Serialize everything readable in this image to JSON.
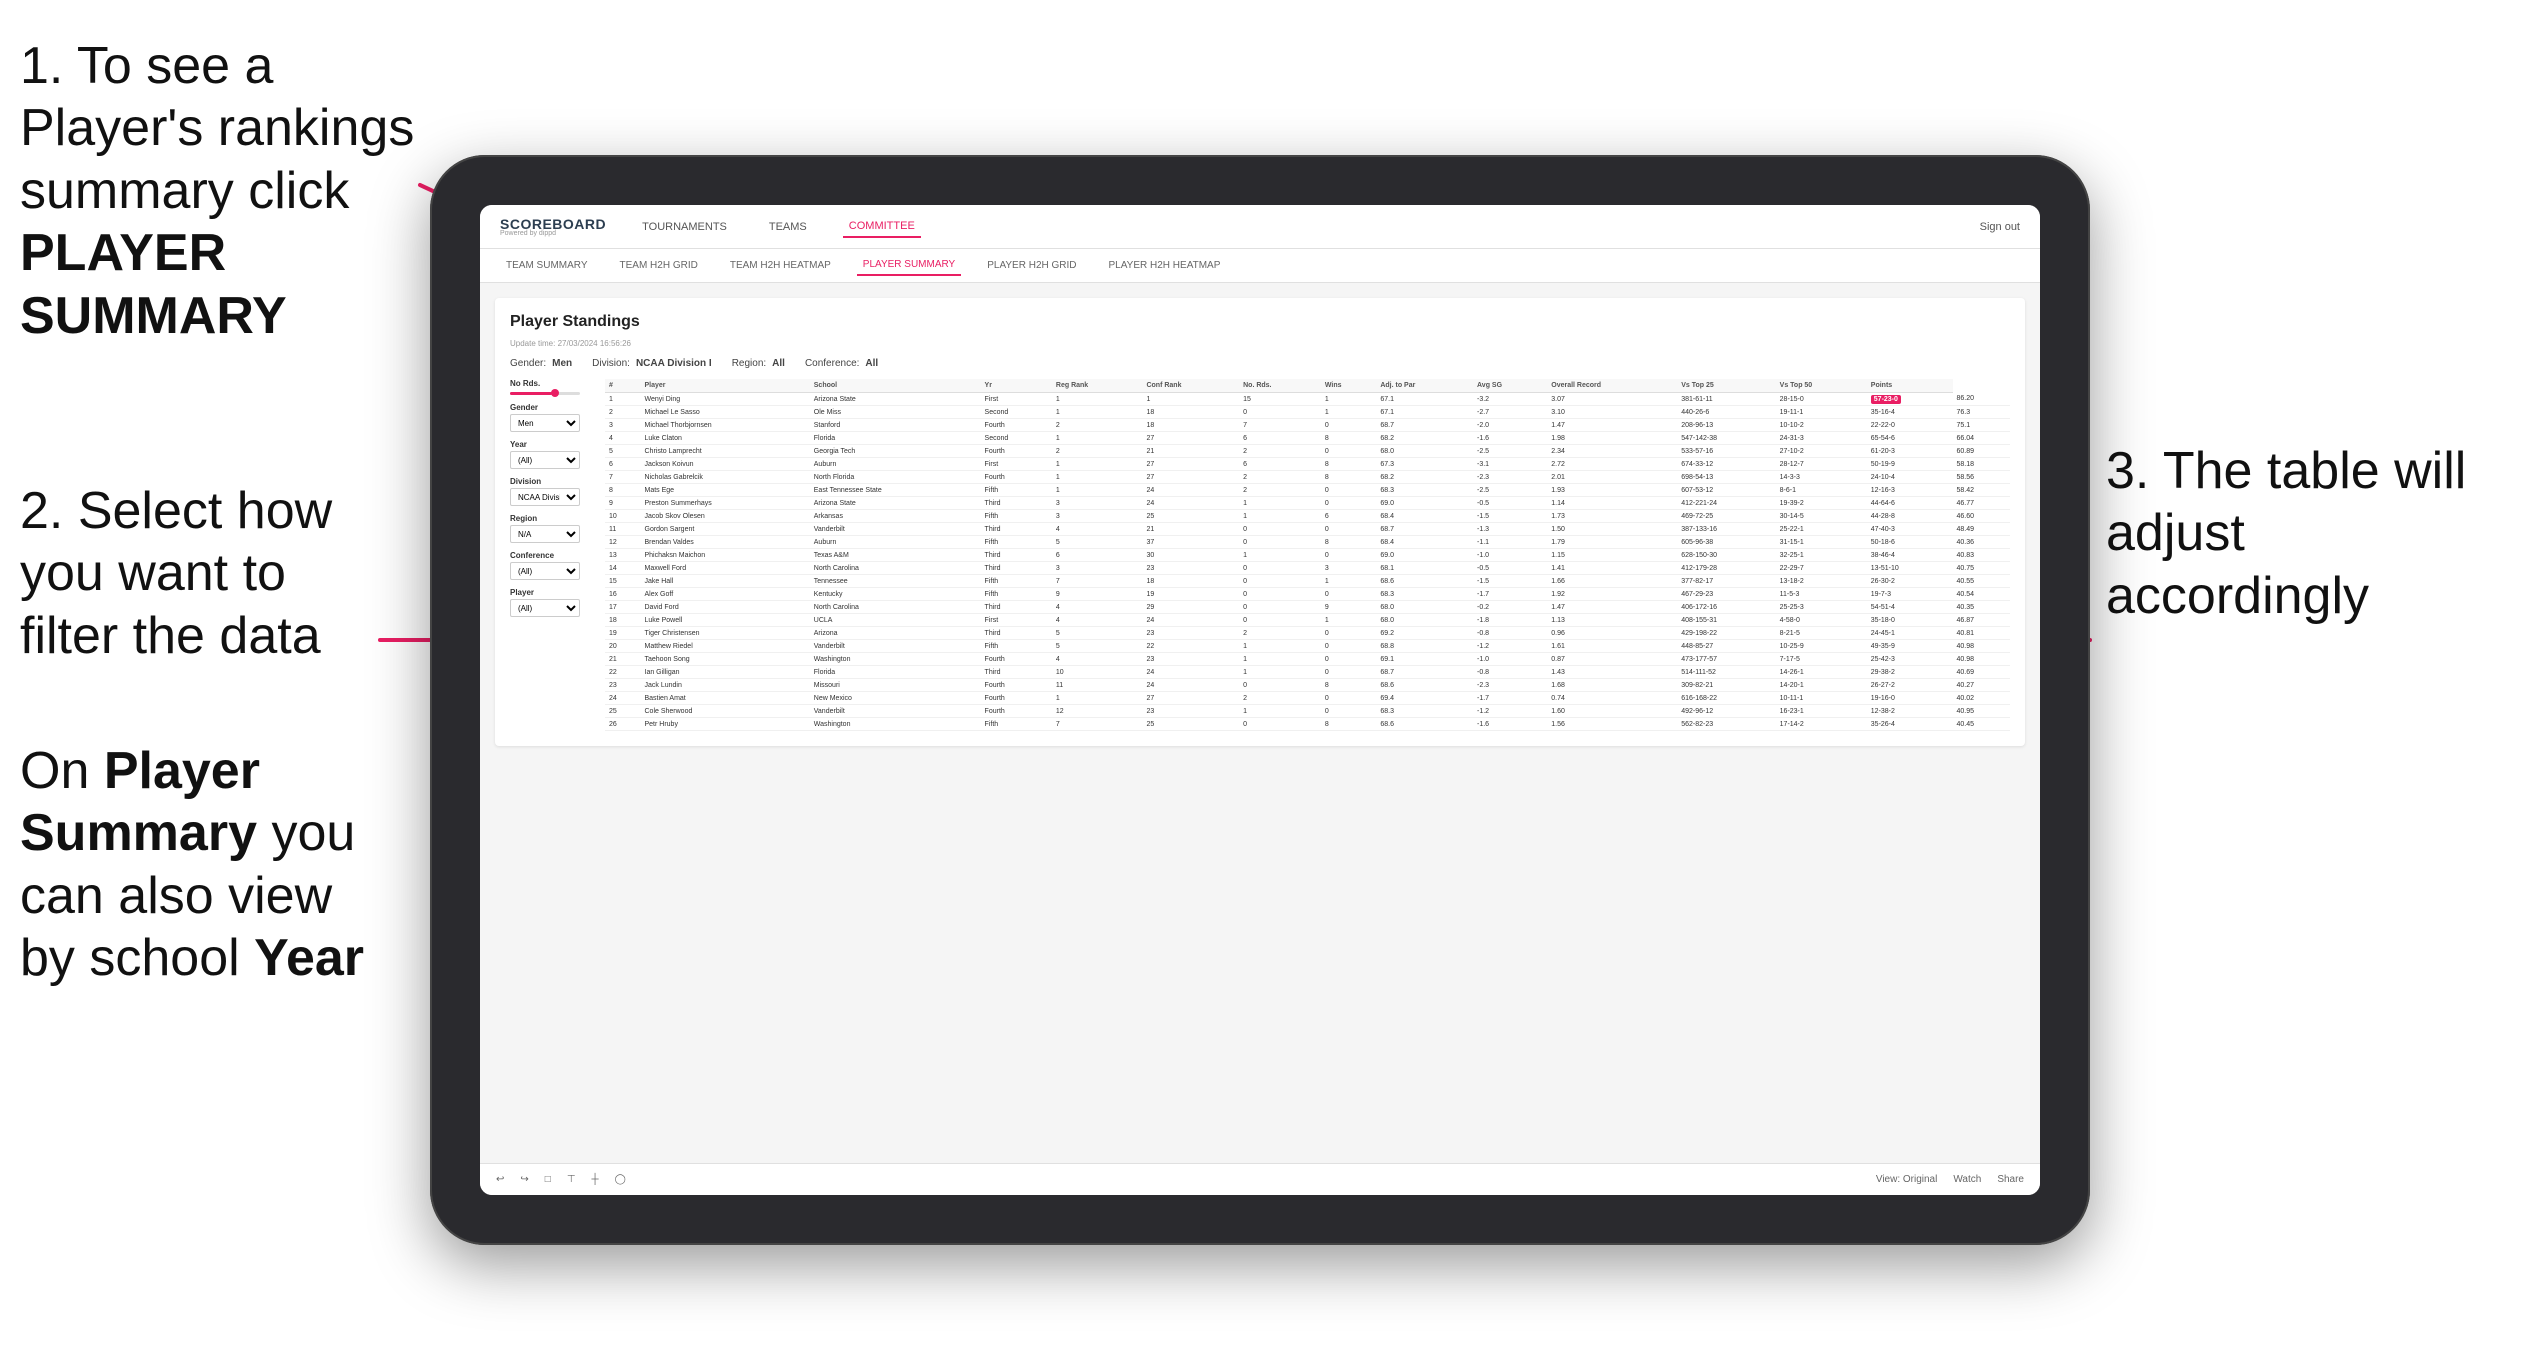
{
  "instructions": {
    "step1": "1. To see a Player's rankings summary click ",
    "step1_bold": "PLAYER SUMMARY",
    "step2_intro": "2. Select how you want to",
    "step2_main": "filter the data",
    "step_bottom_intro": "On ",
    "step_bottom_bold1": "Player Summary",
    "step_bottom_text": " you can also view by school ",
    "step_bottom_bold2": "Year",
    "step3": "3. The table will adjust accordingly"
  },
  "app": {
    "logo": "SCOREBOARD",
    "logo_sub": "Powered by dippd",
    "nav": [
      "TOURNAMENTS",
      "TEAMS",
      "COMMITTEE"
    ],
    "header_right": "Sign out",
    "subnav": [
      "TEAM SUMMARY",
      "TEAM H2H GRID",
      "TEAM H2H HEATMAP",
      "PLAYER SUMMARY",
      "PLAYER H2H GRID",
      "PLAYER H2H HEATMAP"
    ]
  },
  "panel": {
    "title": "Player Standings",
    "update_time": "Update time: 27/03/2024 16:56:26",
    "filters": {
      "gender_label": "Gender:",
      "gender_value": "Men",
      "division_label": "Division:",
      "division_value": "NCAA Division I",
      "region_label": "Region:",
      "region_value": "All",
      "conference_label": "Conference:",
      "conference_value": "All"
    },
    "sidebar": {
      "no_rds_label": "No Rds.",
      "gender_label": "Gender",
      "gender_value": "Men",
      "year_label": "Year",
      "year_value": "(All)",
      "division_label": "Division",
      "division_value": "NCAA Division I",
      "region_label": "Region",
      "region_value": "N/A",
      "conference_label": "Conference",
      "conference_value": "(All)",
      "player_label": "Player",
      "player_value": "(All)"
    },
    "table": {
      "headers": [
        "#",
        "Player",
        "School",
        "Yr",
        "Reg Rank",
        "Conf Rank",
        "No. Rds.",
        "Wins",
        "Adj. to Par",
        "Avg SG",
        "Overall Record",
        "Vs Top 25",
        "Vs Top 50",
        "Points"
      ],
      "rows": [
        [
          "1",
          "Wenyi Ding",
          "Arizona State",
          "First",
          "1",
          "1",
          "15",
          "1",
          "67.1",
          "-3.2",
          "3.07",
          "381-61-11",
          "28-15-0",
          "57-23-0",
          "86.20"
        ],
        [
          "2",
          "Michael Le Sasso",
          "Ole Miss",
          "Second",
          "1",
          "18",
          "0",
          "1",
          "67.1",
          "-2.7",
          "3.10",
          "440-26-6",
          "19-11-1",
          "35-16-4",
          "76.3"
        ],
        [
          "3",
          "Michael Thorbjornsen",
          "Stanford",
          "Fourth",
          "2",
          "18",
          "7",
          "0",
          "68.7",
          "-2.0",
          "1.47",
          "208-96-13",
          "10-10-2",
          "22-22-0",
          "75.1"
        ],
        [
          "4",
          "Luke Claton",
          "Florida",
          "Second",
          "1",
          "27",
          "6",
          "8",
          "68.2",
          "-1.6",
          "1.98",
          "547-142-38",
          "24-31-3",
          "65-54-6",
          "66.04"
        ],
        [
          "5",
          "Christo Lamprecht",
          "Georgia Tech",
          "Fourth",
          "2",
          "21",
          "2",
          "0",
          "68.0",
          "-2.5",
          "2.34",
          "533-57-16",
          "27-10-2",
          "61-20-3",
          "60.89"
        ],
        [
          "6",
          "Jackson Koivun",
          "Auburn",
          "First",
          "1",
          "27",
          "6",
          "8",
          "67.3",
          "-3.1",
          "2.72",
          "674-33-12",
          "28-12-7",
          "50-19-9",
          "58.18"
        ],
        [
          "7",
          "Nicholas Gabrelcik",
          "North Florida",
          "Fourth",
          "1",
          "27",
          "2",
          "8",
          "68.2",
          "-2.3",
          "2.01",
          "698-54-13",
          "14-3-3",
          "24-10-4",
          "58.56"
        ],
        [
          "8",
          "Mats Ege",
          "East Tennessee State",
          "Fifth",
          "1",
          "24",
          "2",
          "0",
          "68.3",
          "-2.5",
          "1.93",
          "607-53-12",
          "8-6-1",
          "12-16-3",
          "58.42"
        ],
        [
          "9",
          "Preston Summerhays",
          "Arizona State",
          "Third",
          "3",
          "24",
          "1",
          "0",
          "69.0",
          "-0.5",
          "1.14",
          "412-221-24",
          "19-39-2",
          "44-64-6",
          "46.77"
        ],
        [
          "10",
          "Jacob Skov Olesen",
          "Arkansas",
          "Fifth",
          "3",
          "25",
          "1",
          "6",
          "68.4",
          "-1.5",
          "1.73",
          "469-72-25",
          "30-14-5",
          "44-28-8",
          "46.60"
        ],
        [
          "11",
          "Gordon Sargent",
          "Vanderbilt",
          "Third",
          "4",
          "21",
          "0",
          "0",
          "68.7",
          "-1.3",
          "1.50",
          "387-133-16",
          "25-22-1",
          "47-40-3",
          "48.49"
        ],
        [
          "12",
          "Brendan Valdes",
          "Auburn",
          "Fifth",
          "5",
          "37",
          "0",
          "8",
          "68.4",
          "-1.1",
          "1.79",
          "605-96-38",
          "31-15-1",
          "50-18-6",
          "40.36"
        ],
        [
          "13",
          "Phichaksn Maichon",
          "Texas A&M",
          "Third",
          "6",
          "30",
          "1",
          "0",
          "69.0",
          "-1.0",
          "1.15",
          "628-150-30",
          "32-25-1",
          "38-46-4",
          "40.83"
        ],
        [
          "14",
          "Maxwell Ford",
          "North Carolina",
          "Third",
          "3",
          "23",
          "0",
          "3",
          "68.1",
          "-0.5",
          "1.41",
          "412-179-28",
          "22-29-7",
          "13-51-10",
          "40.75"
        ],
        [
          "15",
          "Jake Hall",
          "Tennessee",
          "Fifth",
          "7",
          "18",
          "0",
          "1",
          "68.6",
          "-1.5",
          "1.66",
          "377-82-17",
          "13-18-2",
          "26-30-2",
          "40.55"
        ],
        [
          "16",
          "Alex Goff",
          "Kentucky",
          "Fifth",
          "9",
          "19",
          "0",
          "0",
          "68.3",
          "-1.7",
          "1.92",
          "467-29-23",
          "11-5-3",
          "19-7-3",
          "40.54"
        ],
        [
          "17",
          "David Ford",
          "North Carolina",
          "Third",
          "4",
          "29",
          "0",
          "9",
          "68.0",
          "-0.2",
          "1.47",
          "406-172-16",
          "25-25-3",
          "54-51-4",
          "40.35"
        ],
        [
          "18",
          "Luke Powell",
          "UCLA",
          "First",
          "4",
          "24",
          "0",
          "1",
          "68.0",
          "-1.8",
          "1.13",
          "408-155-31",
          "4-58-0",
          "35-18-0",
          "46.87"
        ],
        [
          "19",
          "Tiger Christensen",
          "Arizona",
          "Third",
          "5",
          "23",
          "2",
          "0",
          "69.2",
          "-0.8",
          "0.96",
          "429-198-22",
          "8-21-5",
          "24-45-1",
          "40.81"
        ],
        [
          "20",
          "Matthew Riedel",
          "Vanderbilt",
          "Fifth",
          "5",
          "22",
          "1",
          "0",
          "68.8",
          "-1.2",
          "1.61",
          "448-85-27",
          "10-25-9",
          "49-35-9",
          "40.98"
        ],
        [
          "21",
          "Taehoon Song",
          "Washington",
          "Fourth",
          "4",
          "23",
          "1",
          "0",
          "69.1",
          "-1.0",
          "0.87",
          "473-177-57",
          "7-17-5",
          "25-42-3",
          "40.98"
        ],
        [
          "22",
          "Ian Gilligan",
          "Florida",
          "Third",
          "10",
          "24",
          "1",
          "0",
          "68.7",
          "-0.8",
          "1.43",
          "514-111-52",
          "14-26-1",
          "29-38-2",
          "40.69"
        ],
        [
          "23",
          "Jack Lundin",
          "Missouri",
          "Fourth",
          "11",
          "24",
          "0",
          "8",
          "68.6",
          "-2.3",
          "1.68",
          "309-82-21",
          "14-20-1",
          "26-27-2",
          "40.27"
        ],
        [
          "24",
          "Bastien Amat",
          "New Mexico",
          "Fourth",
          "1",
          "27",
          "2",
          "0",
          "69.4",
          "-1.7",
          "0.74",
          "616-168-22",
          "10-11-1",
          "19-16-0",
          "40.02"
        ],
        [
          "25",
          "Cole Sherwood",
          "Vanderbilt",
          "Fourth",
          "12",
          "23",
          "1",
          "0",
          "68.3",
          "-1.2",
          "1.60",
          "492-96-12",
          "16-23-1",
          "12-38-2",
          "40.95"
        ],
        [
          "26",
          "Petr Hruby",
          "Washington",
          "Fifth",
          "7",
          "25",
          "0",
          "8",
          "68.6",
          "-1.6",
          "1.56",
          "562-82-23",
          "17-14-2",
          "35-26-4",
          "40.45"
        ]
      ]
    }
  },
  "toolbar": {
    "view_label": "View: Original",
    "watch_label": "Watch",
    "share_label": "Share"
  }
}
